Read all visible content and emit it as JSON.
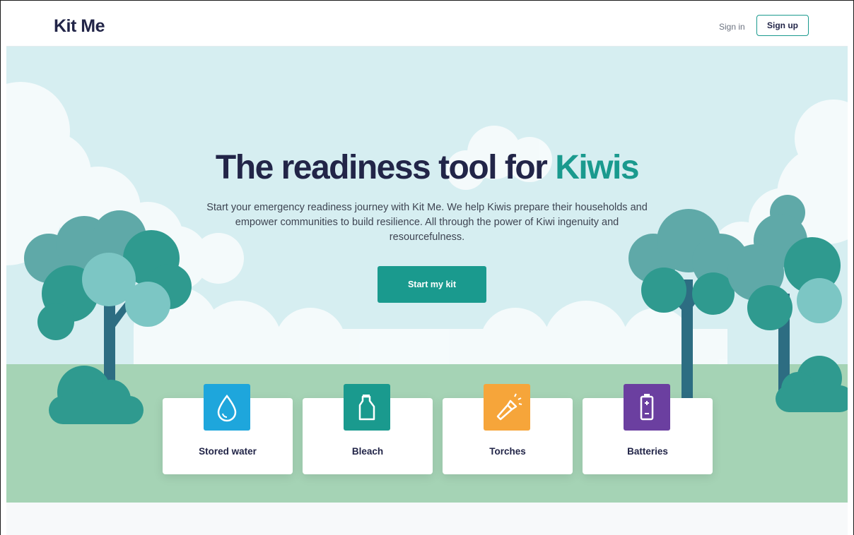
{
  "header": {
    "logo": "Kit Me",
    "sign_in": "Sign in",
    "sign_up": "Sign up"
  },
  "hero": {
    "title_main": "The readiness tool for ",
    "title_accent": "Kiwis",
    "subtitle": "Start your emergency readiness journey with Kit Me. We help Kiwis prepare their households and empower communities to build resilience. All through the power of Kiwi ingenuity and resourcefulness.",
    "cta": "Start my kit"
  },
  "items": [
    {
      "label": "Stored water",
      "icon": "water-drop-icon",
      "color": "#1ea6dc"
    },
    {
      "label": "Bleach",
      "icon": "bleach-bottle-icon",
      "color": "#1a9a8e"
    },
    {
      "label": "Torches",
      "icon": "torch-icon",
      "color": "#f6a53a"
    },
    {
      "label": "Batteries",
      "icon": "battery-icon",
      "color": "#6b3fa0"
    }
  ],
  "colors": {
    "brand_dark": "#222548",
    "brand_teal": "#1a9a8e",
    "sky": "#d6eef1",
    "grass": "#a5d3b5"
  }
}
